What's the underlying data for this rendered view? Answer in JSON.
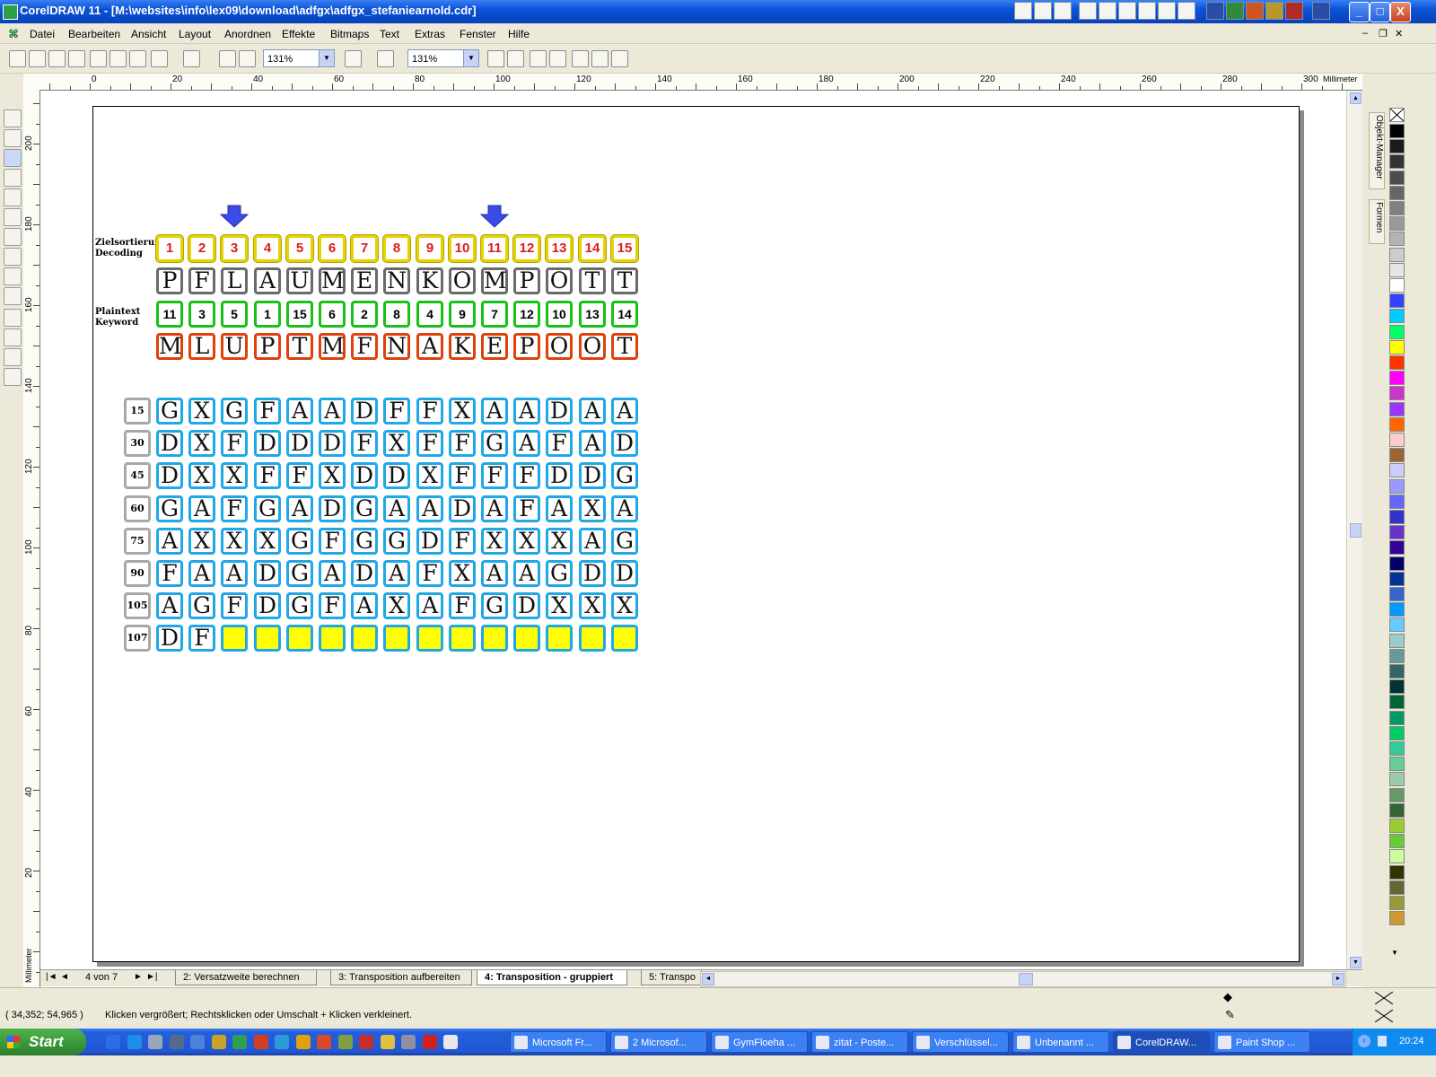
{
  "window": {
    "title": "CorelDRAW 11 - [M:\\websites\\info\\lex09\\download\\adfgx\\adfgx_stefaniearnold.cdr]",
    "minimize": "_",
    "maximize": "□",
    "close": "X"
  },
  "menu": [
    "Datei",
    "Bearbeiten",
    "Ansicht",
    "Layout",
    "Anordnen",
    "Effekte",
    "Bitmaps",
    "Text",
    "Extras",
    "Fenster",
    "Hilfe"
  ],
  "toolbar": {
    "zoom1": "131%",
    "zoom2": "131%"
  },
  "ruler": {
    "unit": "Millimeter",
    "h_labels": [
      "0",
      "20",
      "40",
      "60",
      "80",
      "100",
      "120",
      "140",
      "160",
      "180",
      "200",
      "220",
      "240",
      "260",
      "280",
      "300"
    ],
    "v_labels": [
      "200",
      "180",
      "160",
      "140",
      "120",
      "100",
      "80",
      "60",
      "40",
      "20"
    ]
  },
  "dockers": {
    "objekt_manager": "Objekt-Manager",
    "formen": "Formen"
  },
  "doc": {
    "label_decoding": [
      "Zielsortierung",
      "Decoding"
    ],
    "label_plaintext": [
      "Plaintext",
      "Keyword"
    ],
    "arrows_over": [
      "3",
      "11"
    ],
    "numbers": [
      "1",
      "2",
      "3",
      "4",
      "5",
      "6",
      "7",
      "8",
      "9",
      "10",
      "11",
      "12",
      "13",
      "14",
      "15"
    ],
    "plaintext": [
      "P",
      "F",
      "L",
      "A",
      "U",
      "M",
      "E",
      "N",
      "K",
      "O",
      "M",
      "P",
      "O",
      "T",
      "T"
    ],
    "keyword": [
      "11",
      "3",
      "5",
      "1",
      "15",
      "6",
      "2",
      "8",
      "4",
      "9",
      "7",
      "12",
      "10",
      "13",
      "14"
    ],
    "ciphertext": [
      "M",
      "L",
      "U",
      "P",
      "T",
      "M",
      "F",
      "N",
      "A",
      "K",
      "E",
      "P",
      "O",
      "O",
      "T"
    ],
    "grid": [
      {
        "row": "15",
        "cells": [
          "G",
          "X",
          "G",
          "F",
          "A",
          "A",
          "D",
          "F",
          "F",
          "X",
          "A",
          "A",
          "D",
          "A",
          "A"
        ]
      },
      {
        "row": "30",
        "cells": [
          "D",
          "X",
          "F",
          "D",
          "D",
          "D",
          "F",
          "X",
          "F",
          "F",
          "G",
          "A",
          "F",
          "A",
          "D"
        ]
      },
      {
        "row": "45",
        "cells": [
          "D",
          "X",
          "X",
          "F",
          "F",
          "X",
          "D",
          "D",
          "X",
          "F",
          "F",
          "F",
          "D",
          "D",
          "G"
        ]
      },
      {
        "row": "60",
        "cells": [
          "G",
          "A",
          "F",
          "G",
          "A",
          "D",
          "G",
          "A",
          "A",
          "D",
          "A",
          "F",
          "A",
          "X",
          "A"
        ]
      },
      {
        "row": "75",
        "cells": [
          "A",
          "X",
          "X",
          "X",
          "G",
          "F",
          "G",
          "G",
          "D",
          "F",
          "X",
          "X",
          "X",
          "A",
          "G"
        ]
      },
      {
        "row": "90",
        "cells": [
          "F",
          "A",
          "A",
          "D",
          "G",
          "A",
          "D",
          "A",
          "F",
          "X",
          "A",
          "A",
          "G",
          "D",
          "D"
        ]
      },
      {
        "row": "105",
        "cells": [
          "A",
          "G",
          "F",
          "D",
          "G",
          "F",
          "A",
          "X",
          "A",
          "F",
          "G",
          "D",
          "X",
          "X",
          "X"
        ]
      },
      {
        "row": "107",
        "cells": [
          "D",
          "F",
          "",
          "",
          "",
          "",
          "",
          "",
          "",
          "",
          "",
          "",
          "",
          "",
          ""
        ]
      }
    ]
  },
  "pagebar": {
    "page_count": "4 von 7",
    "tabs": [
      "2: Versatzweite berechnen",
      "3: Transposition aufbereiten",
      "4: Transposition - gruppiert",
      "5: Transpo"
    ],
    "active_tab": 2
  },
  "status": {
    "coords": "( 34,352; 54,965 )",
    "hint": "Klicken vergrößert; Rechtsklicken oder Umschalt + Klicken verkleinert."
  },
  "taskbar": {
    "start": "Start",
    "tasks": [
      "Microsoft Fr...",
      "2 Microsof...",
      "GymFloeha ...",
      "zitat - Poste...",
      "Verschlüssel...",
      "Unbenannt ...",
      "CorelDRAW...",
      "Paint Shop ..."
    ],
    "active_task": 6,
    "clock": "20:24"
  },
  "colors": {
    "num_border": "#e6d200",
    "plain_border": "#6a6a6a",
    "key_border": "#18c018",
    "cipher_border": "#e0400a",
    "grid_border": "#1fa8e8",
    "empty_fill": "#ffff00",
    "arrow": "#3b4be8",
    "palette": [
      "#000000",
      "#1a1a1a",
      "#333333",
      "#4d4d4d",
      "#666666",
      "#808080",
      "#999999",
      "#b3b3b3",
      "#cccccc",
      "#e6e6e6",
      "#ffffff",
      "#3344ff",
      "#00ccff",
      "#00ff66",
      "#ffff00",
      "#ff3300",
      "#ff00ff",
      "#cc33cc",
      "#9933ff",
      "#ff6600",
      "#ffcccc",
      "#996633",
      "#ccccff",
      "#9999ff",
      "#6666ff",
      "#3333cc",
      "#6633cc",
      "#330099",
      "#000066",
      "#003399",
      "#3366cc",
      "#0099ff",
      "#66ccff",
      "#99cccc",
      "#669999",
      "#336666",
      "#003333",
      "#006633",
      "#009966",
      "#00cc66",
      "#33cc99",
      "#66cc99",
      "#99ccaa",
      "#669966",
      "#336633",
      "#99cc33",
      "#66cc33",
      "#ccff99",
      "#333300",
      "#666633",
      "#999933",
      "#cc9933"
    ]
  }
}
